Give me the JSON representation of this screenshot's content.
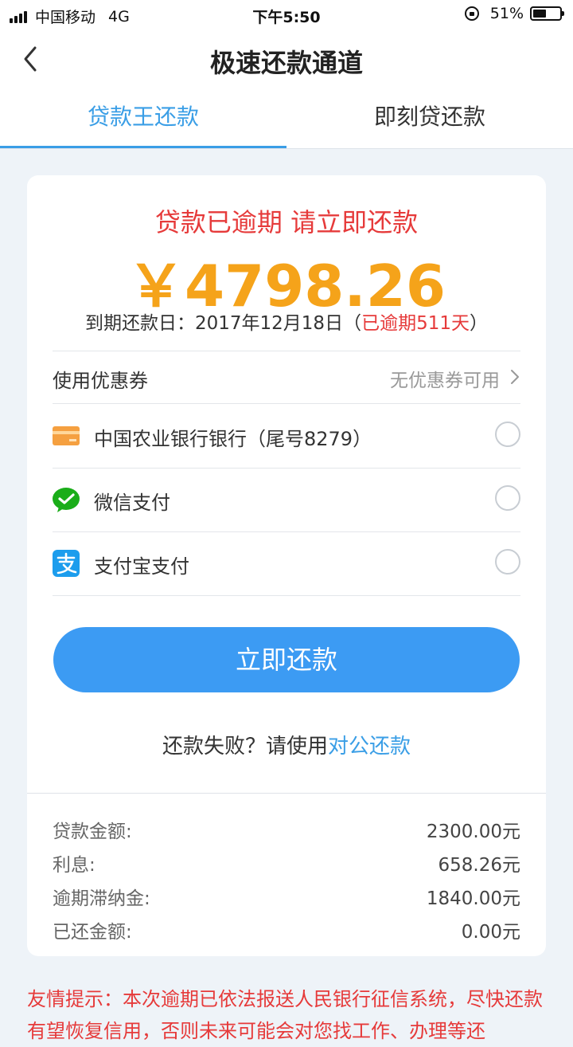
{
  "status_bar": {
    "carrier": "中国移动",
    "network": "4G",
    "time": "下午5:50",
    "battery": "51%",
    "battery_level": 0.51
  },
  "nav": {
    "title": "极速还款通道",
    "back_icon": "chevron-left-icon"
  },
  "tabs": [
    {
      "label": "贷款王还款",
      "active": true
    },
    {
      "label": "即刻贷还款",
      "active": false
    }
  ],
  "summary_card": {
    "warning": "贷款已逾期 请立即还款",
    "amount": "￥4798.26",
    "due_label": "到期还款日：2017年12月18日（",
    "overdue": "已逾期511天",
    "due_close": "）"
  },
  "coupon": {
    "label": "使用优惠券",
    "value": "无优惠券可用"
  },
  "payment_methods": [
    {
      "label": "中国农业银行银行（尾号8279）",
      "icon": "bank-card-icon"
    },
    {
      "label": "微信支付",
      "icon": "wechat-pay-icon"
    },
    {
      "label": "支付宝支付",
      "icon": "alipay-icon"
    }
  ],
  "pay_button": "立即还款",
  "fail_note": {
    "text": "还款失败？请使用",
    "link": "对公还款"
  },
  "details": [
    {
      "label": "贷款金额:",
      "value": "2300.00元"
    },
    {
      "label": "利息:",
      "value": "658.26元"
    },
    {
      "label": "逾期滞纳金:",
      "value": "1840.00元"
    },
    {
      "label": "已还金额:",
      "value": "0.00元"
    }
  ],
  "tip": "友情提示：本次逾期已依法报送人民银行征信系统，尽快还款有望恢复信用，否则未来可能会对您找工作、办理等还",
  "colors": {
    "accent": "#3a9ee6",
    "warning": "#e63a3a",
    "amount": "#f5a31a",
    "button": "#3c9bf3"
  }
}
